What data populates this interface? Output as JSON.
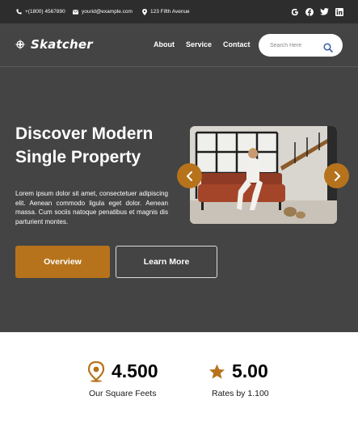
{
  "topbar": {
    "phone": "+(1800) 4567890",
    "email": "yourid@example.com",
    "address": "123 Fifth Avenue",
    "social": [
      "google-icon",
      "facebook-icon",
      "twitter-icon",
      "linkedin-icon"
    ]
  },
  "header": {
    "logo_text": "Skatcher",
    "nav": [
      {
        "label": "About"
      },
      {
        "label": "Service"
      },
      {
        "label": "Contact"
      }
    ],
    "search_placeholder": "Search Here"
  },
  "hero": {
    "title_line1": "Discover Modern",
    "title_line2": "Single Property",
    "description": "Lorem ipsum dolor sit amet, consectetuer adipiscing elit. Aenean commodo ligula eget dolor. Aenean massa. Cum sociis natoque penatibus et magnis dis parturient montes.",
    "primary_button": "Overview",
    "secondary_button": "Learn More"
  },
  "stats": [
    {
      "value": "4.500",
      "label": "Our Square Feets",
      "icon": "location-pin-icon"
    },
    {
      "value": "5.00",
      "label": "Rates by 1.100",
      "icon": "star-icon"
    }
  ],
  "colors": {
    "accent": "#b6731c",
    "hero_bg": "#444444",
    "topbar_bg": "#2d2d2d",
    "search_icon": "#3b5ba5"
  }
}
